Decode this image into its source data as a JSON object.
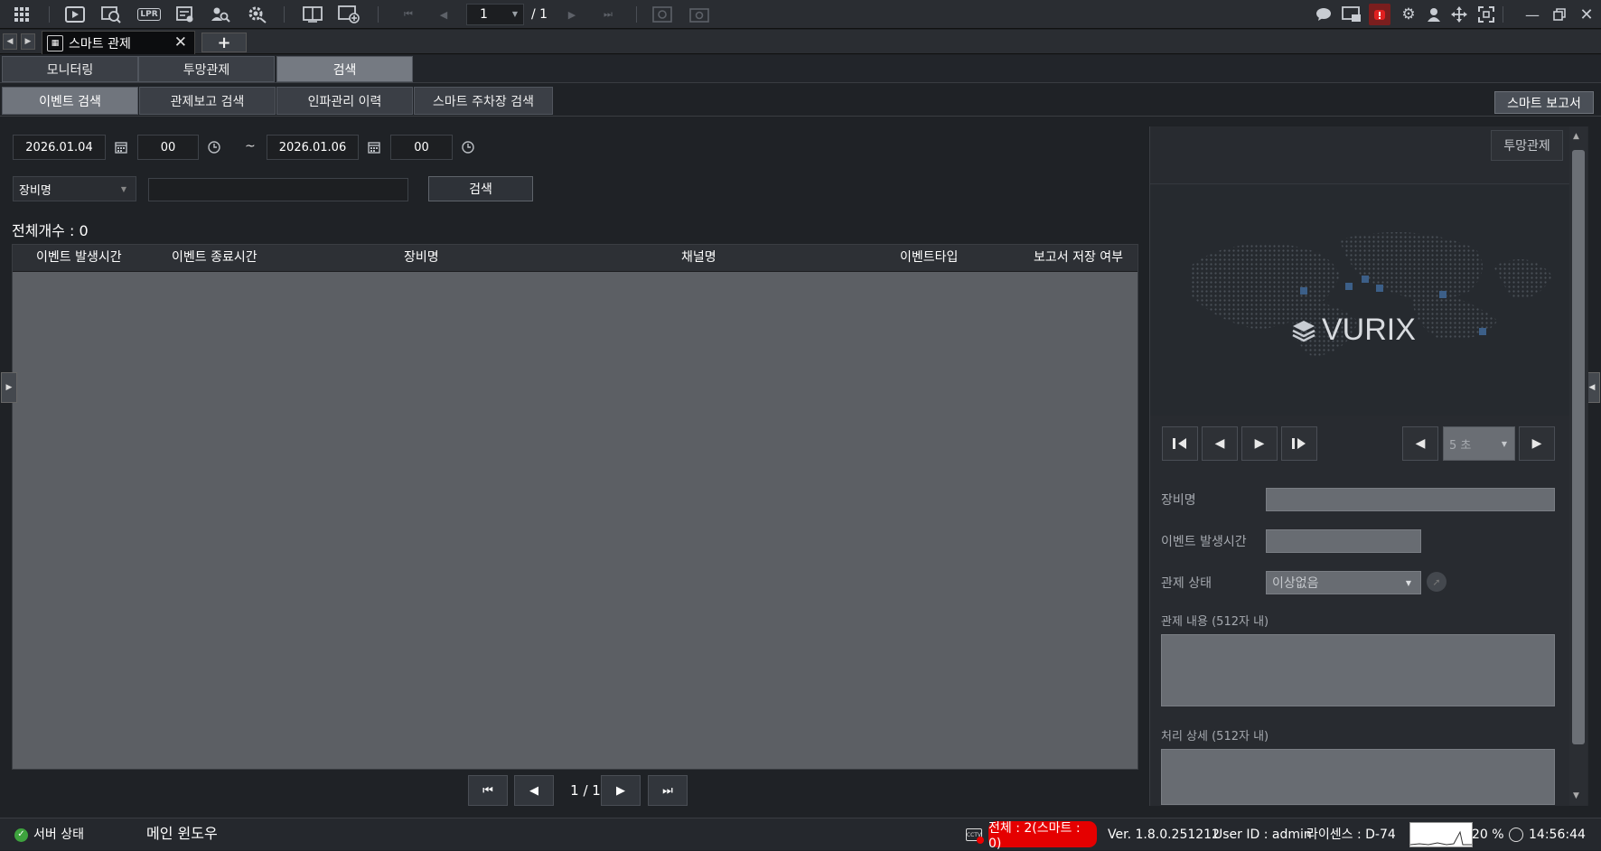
{
  "toolbar": {
    "icons": [
      "grid-icon",
      "play-icon",
      "playback-search-icon",
      "lpr-icon",
      "event-list-icon",
      "person-search-icon",
      "settings-search-icon",
      "layout-icon",
      "add-screen-icon",
      "first-page-icon",
      "prev-page-icon",
      "next-page-icon",
      "last-page-icon",
      "refresh-icon",
      "capture-icon",
      "chat-icon",
      "notice-icon",
      "alarm-icon",
      "gear-icon",
      "user-icon",
      "move-icon",
      "fullscreen-icon",
      "minimize-icon",
      "restore-icon",
      "close-icon"
    ],
    "lpr_label": "LPR",
    "page_value": "1",
    "page_total": "/ 1",
    "alarm_color": "#e02020"
  },
  "tabs": {
    "doc_tab_label": "스마트 관제",
    "add_tab_label": "+"
  },
  "main_tabs": [
    {
      "label": "모니터링",
      "active": false
    },
    {
      "label": "투망관제",
      "active": false
    },
    {
      "label": "검색",
      "active": true
    }
  ],
  "sub_tabs": [
    {
      "label": "이벤트 검색",
      "active": true
    },
    {
      "label": "관제보고 검색",
      "active": false
    },
    {
      "label": "인파관리 이력",
      "active": false
    },
    {
      "label": "스마트 주차장 검색",
      "active": false
    }
  ],
  "smart_report_label": "스마트 보고서",
  "search": {
    "start_date": "2026.01.04",
    "start_hour": "00",
    "tilde": "~",
    "end_date": "2026.01.06",
    "end_hour": "00",
    "filter_select": "장비명",
    "keyword": "",
    "search_button": "검색"
  },
  "results": {
    "total_count": "전체개수 : 0",
    "columns": [
      "이벤트 발생시간",
      "이벤트 종료시간",
      "장비명",
      "채널명",
      "이벤트타입",
      "보고서 저장 여부"
    ],
    "rows": []
  },
  "pager": {
    "text": "1 / 1",
    "first": "⏮",
    "prev": "◀",
    "next": "▶",
    "last": "⏭"
  },
  "right_panel": {
    "tab_button": "투망관제",
    "logo_text": "VURIX",
    "interval": "5 초",
    "labels": {
      "device": "장비명",
      "event_time": "이벤트 발생시간",
      "status": "관제 상태",
      "content": "관제 내용 (512자 내)",
      "detail": "처리 상세 (512자 내)"
    },
    "device_value": "",
    "event_time_value": "",
    "status_value": "이상없음",
    "content_value": "",
    "detail_value": ""
  },
  "statusbar": {
    "server_status": "서버 상태",
    "main_window": "메인 윈도우",
    "alarm_count": "전체 : 2(스마트 : 0)",
    "alarm_color": "#e50000",
    "version": "Ver. 1.8.0.251212",
    "user_id": "User ID : admin",
    "license": "라이센스 : D-74",
    "cpu": "20 %",
    "time": "14:56:44"
  }
}
